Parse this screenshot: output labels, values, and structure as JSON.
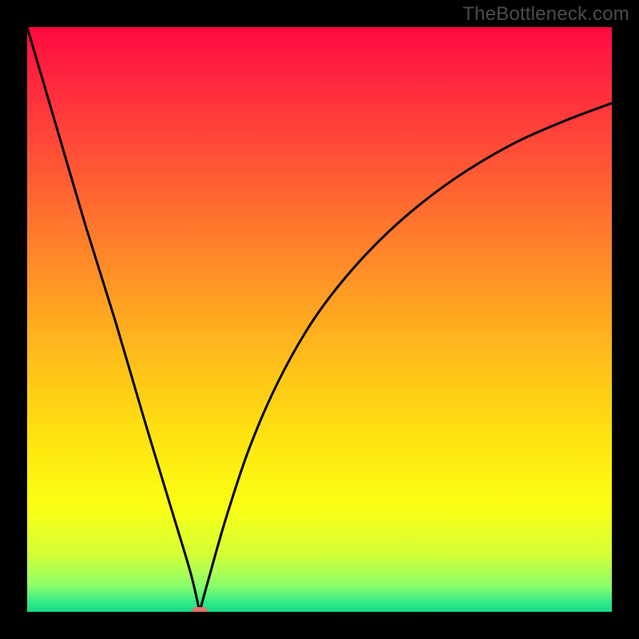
{
  "watermark": "TheBottleneck.com",
  "colors": {
    "marker": "#e2736e",
    "curve": "#000000",
    "gradient_stops": [
      {
        "pos": 0.0,
        "color": "#ff0a40"
      },
      {
        "pos": 0.1,
        "color": "#ff2a3e"
      },
      {
        "pos": 0.25,
        "color": "#ff5a34"
      },
      {
        "pos": 0.4,
        "color": "#ff8a28"
      },
      {
        "pos": 0.55,
        "color": "#ffb91c"
      },
      {
        "pos": 0.7,
        "color": "#ffe310"
      },
      {
        "pos": 0.82,
        "color": "#fbff14"
      },
      {
        "pos": 0.9,
        "color": "#d6ff35"
      },
      {
        "pos": 0.955,
        "color": "#8cff6a"
      },
      {
        "pos": 0.985,
        "color": "#30e989"
      },
      {
        "pos": 1.0,
        "color": "#17d98a"
      }
    ]
  },
  "chart_data": {
    "type": "line",
    "title": "",
    "xlabel": "",
    "ylabel": "",
    "xlim": [
      0,
      1
    ],
    "ylim": [
      0,
      1
    ],
    "notes": "V-shaped bottleneck curve. Left branch descends roughly linearly from top-left to the minimum; right branch rises with decreasing slope (concave) toward the right edge. Minimum y≈0 at x≈0.295. Red rounded marker sits at the minimum.",
    "series": [
      {
        "name": "bottleneck-curve",
        "x": [
          0.0,
          0.05,
          0.1,
          0.15,
          0.2,
          0.25,
          0.28,
          0.295,
          0.31,
          0.34,
          0.38,
          0.43,
          0.49,
          0.56,
          0.64,
          0.73,
          0.83,
          0.92,
          1.0
        ],
        "y": [
          1.0,
          0.83,
          0.66,
          0.5,
          0.33,
          0.165,
          0.065,
          0.0,
          0.055,
          0.16,
          0.28,
          0.395,
          0.5,
          0.59,
          0.67,
          0.74,
          0.8,
          0.84,
          0.87
        ]
      }
    ],
    "marker": {
      "x": 0.295,
      "y": 0.0
    }
  }
}
